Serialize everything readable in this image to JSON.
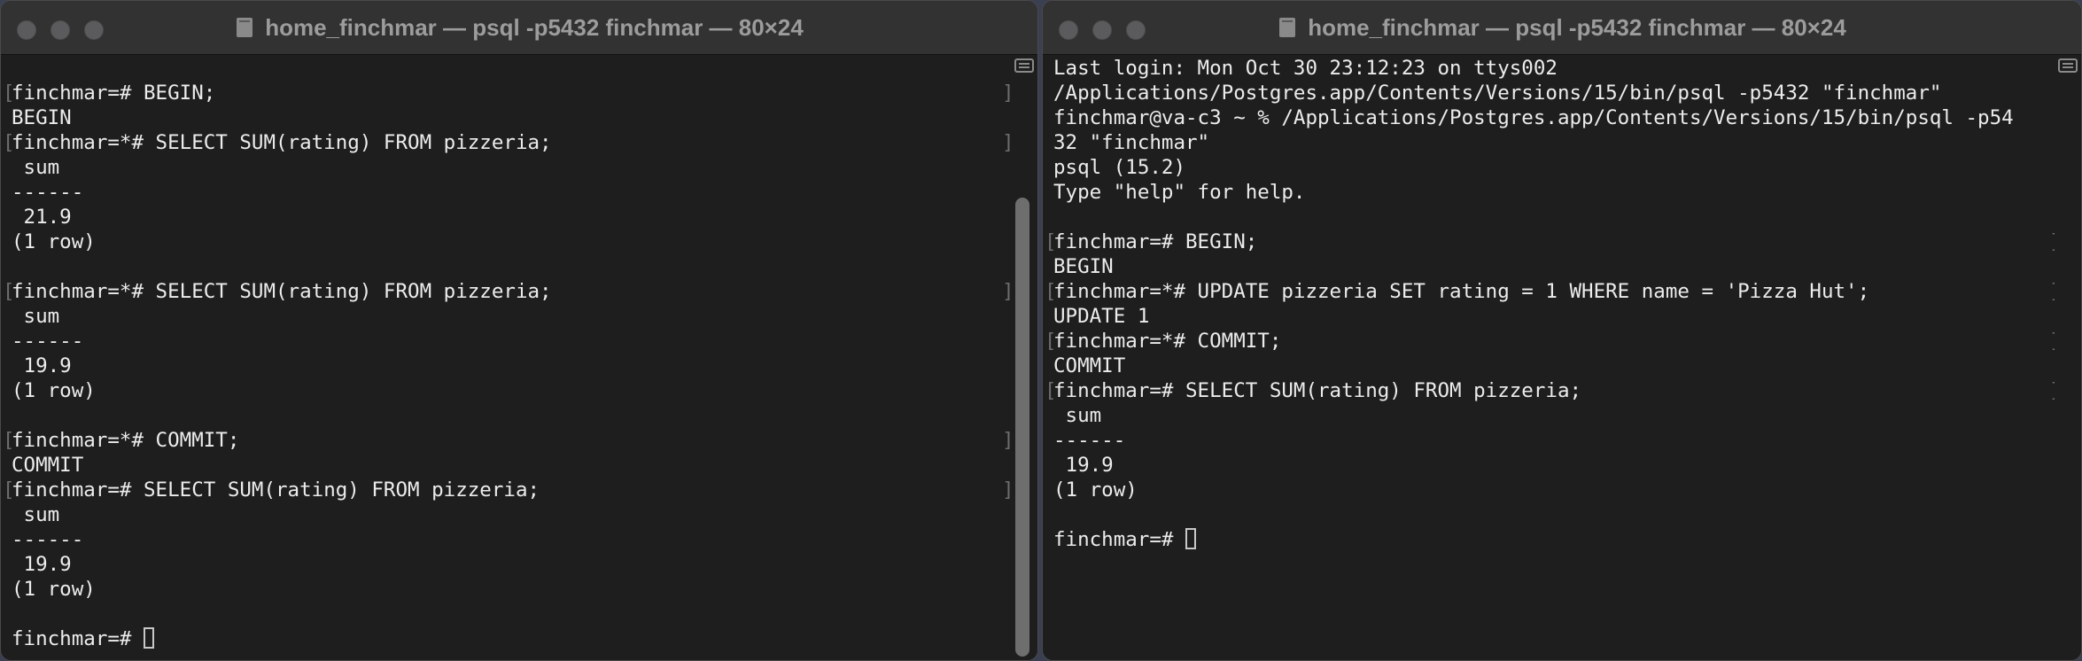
{
  "left_window": {
    "title": "home_finchmar — psql -p5432 finchmar — 80×24",
    "scrollbar_position": 0.3,
    "lines": [
      {
        "text": "",
        "marked": false
      },
      {
        "text": "finchmar=# BEGIN;",
        "marked": true
      },
      {
        "text": "BEGIN",
        "marked": false
      },
      {
        "text": "finchmar=*# SELECT SUM(rating) FROM pizzeria;",
        "marked": true
      },
      {
        "text": " sum",
        "marked": false
      },
      {
        "text": "------",
        "marked": false
      },
      {
        "text": " 21.9",
        "marked": false
      },
      {
        "text": "(1 row)",
        "marked": false
      },
      {
        "text": "",
        "marked": false
      },
      {
        "text": "finchmar=*# SELECT SUM(rating) FROM pizzeria;",
        "marked": true
      },
      {
        "text": " sum",
        "marked": false
      },
      {
        "text": "------",
        "marked": false
      },
      {
        "text": " 19.9",
        "marked": false
      },
      {
        "text": "(1 row)",
        "marked": false
      },
      {
        "text": "",
        "marked": false
      },
      {
        "text": "finchmar=*# COMMIT;",
        "marked": true
      },
      {
        "text": "COMMIT",
        "marked": false
      },
      {
        "text": "finchmar=# SELECT SUM(rating) FROM pizzeria;",
        "marked": true
      },
      {
        "text": " sum",
        "marked": false
      },
      {
        "text": "------",
        "marked": false
      },
      {
        "text": " 19.9",
        "marked": false
      },
      {
        "text": "(1 row)",
        "marked": false
      },
      {
        "text": "",
        "marked": false
      },
      {
        "text": "finchmar=# ",
        "marked": false,
        "cursor": true
      }
    ]
  },
  "right_window": {
    "title": "home_finchmar — psql -p5432 finchmar — 80×24",
    "lines": [
      {
        "text": "Last login: Mon Oct 30 23:12:23 on ttys002",
        "marked": false
      },
      {
        "text": "/Applications/Postgres.app/Contents/Versions/15/bin/psql -p5432 \"finchmar\"",
        "marked": false
      },
      {
        "text": "finchmar@va-c3 ~ % /Applications/Postgres.app/Contents/Versions/15/bin/psql -p54",
        "marked": false
      },
      {
        "text": "32 \"finchmar\"",
        "marked": false
      },
      {
        "text": "psql (15.2)",
        "marked": false
      },
      {
        "text": "Type \"help\" for help.",
        "marked": false
      },
      {
        "text": "",
        "marked": false
      },
      {
        "text": "finchmar=# BEGIN;",
        "marked": true
      },
      {
        "text": "BEGIN",
        "marked": false
      },
      {
        "text": "finchmar=*# UPDATE pizzeria SET rating = 1 WHERE name = 'Pizza Hut';",
        "marked": true
      },
      {
        "text": "UPDATE 1",
        "marked": false
      },
      {
        "text": "finchmar=*# COMMIT;",
        "marked": true
      },
      {
        "text": "COMMIT",
        "marked": false
      },
      {
        "text": "finchmar=# SELECT SUM(rating) FROM pizzeria;",
        "marked": true
      },
      {
        "text": " sum",
        "marked": false
      },
      {
        "text": "------",
        "marked": false
      },
      {
        "text": " 19.9",
        "marked": false
      },
      {
        "text": "(1 row)",
        "marked": false
      },
      {
        "text": "",
        "marked": false
      },
      {
        "text": "finchmar=# ",
        "marked": false,
        "cursor": true
      }
    ]
  },
  "icons": {
    "traffic_lights": [
      "close-button",
      "minimize-button",
      "zoom-button"
    ],
    "title_icon": "folder-icon",
    "scroll_icon": "marks-icon"
  },
  "colors": {
    "terminal_bg": "#1e1e1e",
    "terminal_text": "#ececec",
    "titlebar_bg": "#323232",
    "title_text": "#9c9c9c",
    "mark_color": "#6d6d6d"
  }
}
